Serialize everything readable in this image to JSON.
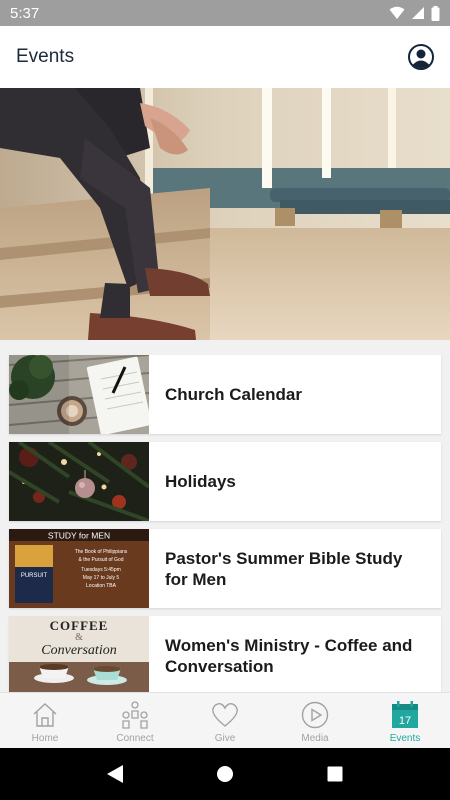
{
  "status_bar": {
    "time": "5:37"
  },
  "app_bar": {
    "title": "Events"
  },
  "events": [
    {
      "title": "Church Calendar"
    },
    {
      "title": "Holidays"
    },
    {
      "title": "Pastor's Summer Bible Study for Men"
    },
    {
      "title": "Women's Ministry - Coffee and Conversation"
    }
  ],
  "thumb_text": {
    "bible_study_heading": "STUDY for MEN",
    "bible_study_book": "PURSUIT",
    "bible_study_line1": "The Book of Philippians",
    "bible_study_line2": "& the Pursuit of God",
    "bible_study_line3": "Tuesdays 5:45pm",
    "bible_study_line4": "May 17 to July 5",
    "bible_study_line5": "Location TBA",
    "coffee_word": "COFFEE",
    "coffee_amp": "&",
    "conversation_word": "Conversation"
  },
  "bottom_nav": [
    {
      "label": "Home",
      "icon": "home-icon"
    },
    {
      "label": "Connect",
      "icon": "connect-icon"
    },
    {
      "label": "Give",
      "icon": "heart-icon"
    },
    {
      "label": "Media",
      "icon": "play-icon"
    },
    {
      "label": "Events",
      "icon": "calendar-icon",
      "badge": "17"
    }
  ],
  "colors": {
    "accent": "#20a8a0",
    "title": "#1c2a3a",
    "status_bar": "#9e9e9e"
  }
}
